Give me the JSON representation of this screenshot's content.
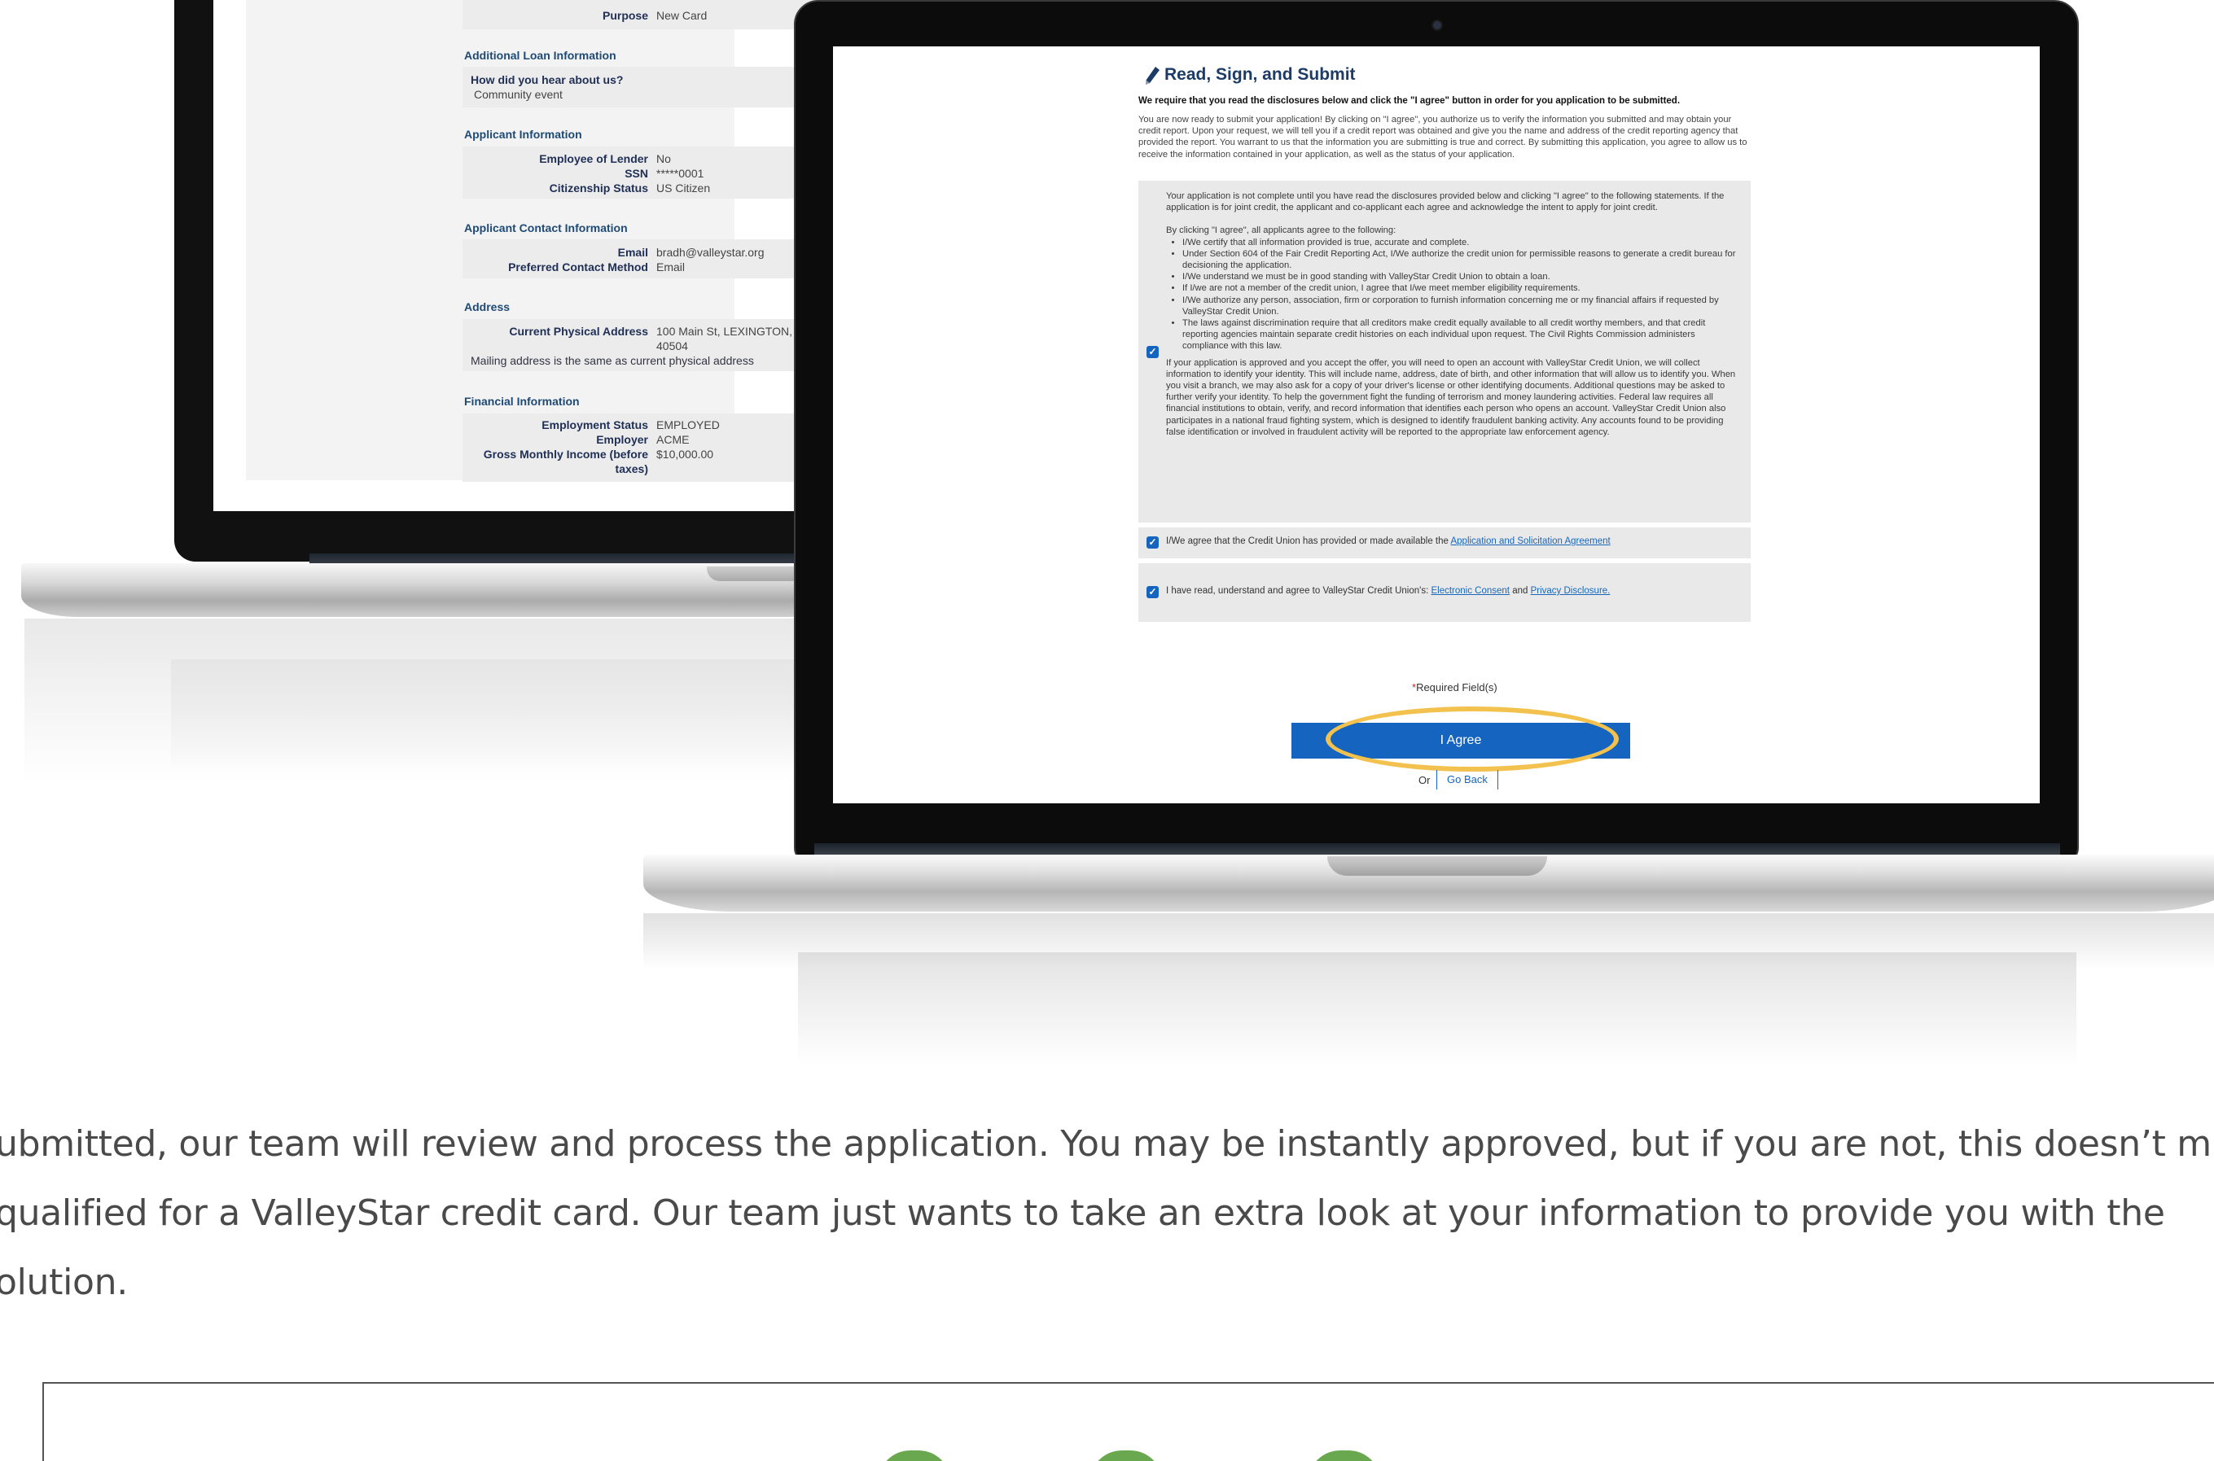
{
  "back_screen": {
    "purpose_label": "Purpose",
    "purpose_value": "New Card",
    "additional_heading": "Additional Loan Information",
    "hear_question": "How did you hear about us?",
    "hear_answer": "Community event",
    "applicant_heading": "Applicant Information",
    "employee_label": "Employee of Lender",
    "employee_value": "No",
    "ssn_label": "SSN",
    "ssn_value": "*****0001",
    "citizenship_label": "Citizenship Status",
    "citizenship_value": "US Citizen",
    "contact_heading": "Applicant Contact Information",
    "email_label": "Email",
    "email_value": "bradh@valleystar.org",
    "preferred_label": "Preferred Contact Method",
    "preferred_value": "Email",
    "address_heading": "Address",
    "physical_label": "Current Physical Address",
    "physical_value_1": "100 Main St, LEXINGTON,",
    "physical_value_2": "40504",
    "mailing_note": "Mailing address is the same as current physical address",
    "financial_heading": "Financial Information",
    "employment_label": "Employment Status",
    "employment_value": "EMPLOYED",
    "employer_label": "Employer",
    "employer_value": "ACME",
    "income_label_1": "Gross Monthly Income (before",
    "income_label_2": "taxes)",
    "income_value": "$10,000.00"
  },
  "front_screen": {
    "icon": "pencil-icon",
    "title": "Read, Sign, and Submit",
    "requirement": "We require that you read the disclosures below and click the \"I agree\" button in order for you application to be submitted.",
    "intro": "You are now ready to submit your application! By clicking on \"I agree\", you authorize us to verify the information you submitted and may obtain your credit report. Upon your request, we will tell you if a credit report was obtained and give you the name and address of the credit reporting agency that provided the report. You warrant to us that the information you are submitting is true and correct. By submitting this application, you agree to allow us to receive the information contained in your application, as well as the status of your application.",
    "disclosure_intro": "Your application is not complete until you have read the disclosures provided below and clicking \"I agree\" to the following statements. If the application is for joint credit, the applicant and co-applicant each agree and acknowledge the intent to apply for joint credit.",
    "disclosure_lead": "By clicking \"I agree\", all applicants agree to the following:",
    "bullets": [
      "I/We certify that all information provided is true, accurate and complete.",
      "Under Section 604 of the Fair Credit Reporting Act, I/We authorize the credit union for permissible reasons to generate a credit bureau for decisioning the application.",
      "I/We understand we must be in good standing with ValleyStar Credit Union to obtain a loan.",
      "If I/we are not a member of the credit union, I agree that I/we meet member eligibility requirements.",
      "I/We authorize any person, association, firm or corporation to furnish information concerning me or my financial affairs if requested by ValleyStar Credit Union.",
      "The laws against discrimination require that all creditors make credit equally available to all credit worthy members, and that credit reporting agencies maintain separate credit histories on each individual upon request. The Civil Rights Commission administers compliance with this law."
    ],
    "disclosure_outro": "If your application is approved and you accept the offer, you will need to open an account with ValleyStar Credit Union, we will collect information to identify your identity. This will include name, address, date of birth, and other information that will allow us to identify you. When you visit a branch, we may also ask for a copy of your driver's license or other identifying documents. Additional questions may be asked to further verify your identity. To help the government fight the funding of terrorism and money laundering activities. Federal law requires all financial institutions to obtain, verify, and record information that identifies each person who opens an account. ValleyStar Credit Union also participates in a national fraud fighting system, which is designed to identify fraudulent banking activity. Any accounts found to be providing false identification or involved in fraudulent activity will be reported to the appropriate law enforcement agency.",
    "agree1_text": "I/We agree that the Credit Union has provided or made available the",
    "agree1_link": "Application and Solicitation Agreement",
    "agree2_text": "I have read, understand and agree to ValleyStar Credit Union's:",
    "agree2_link1": "Electronic Consent",
    "agree2_and": "and",
    "agree2_link2": "Privacy Disclosure.",
    "required_star": "*",
    "required_text": "Required Field(s)",
    "agree_button": "I Agree",
    "or_text": "Or",
    "go_back": "Go Back"
  },
  "article": {
    "line1": "ubmitted, our team will review and process the application. You may be instantly approved, but if you are not, this doesn’t m",
    "line2": "qualified for a ValleyStar credit card. Our team just wants to take an extra look at your information to provide you with the",
    "line3": "olution."
  },
  "colors": {
    "accent_blue": "#1565c0",
    "highlight_yellow": "#f2c14e",
    "title_navy": "#1c3b66",
    "icon_green": "#6aa84f"
  }
}
